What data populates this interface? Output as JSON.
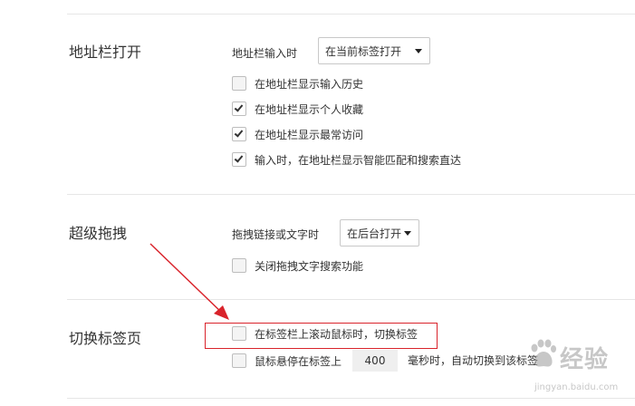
{
  "address_bar": {
    "section_title": "地址栏打开",
    "input_label": "地址栏输入时",
    "input_select": "在当前标签打开",
    "options": [
      {
        "label": "在地址栏显示输入历史",
        "checked": false
      },
      {
        "label": "在地址栏显示个人收藏",
        "checked": true
      },
      {
        "label": "在地址栏显示最常访问",
        "checked": true
      },
      {
        "label": "输入时，在地址栏显示智能匹配和搜索直达",
        "checked": true
      }
    ]
  },
  "drag": {
    "section_title": "超级拖拽",
    "drag_label": "拖拽链接或文字时",
    "drag_select": "在后台打开",
    "option": {
      "label": "关闭拖拽文字搜索功能",
      "checked": false
    }
  },
  "tab_switch": {
    "section_title": "切换标签页",
    "scroll_option": {
      "label": "在标签栏上滚动鼠标时，切换标签",
      "checked": false
    },
    "hover_option": {
      "label": "鼠标悬停在标签上",
      "checked": false
    },
    "hover_ms": "400",
    "hover_suffix": "毫秒时，自动切换到该标签"
  },
  "annotation": {
    "highlight_color": "#d9232b"
  },
  "watermark": {
    "text": "经验",
    "sub": "jingyan.baidu.com",
    "icon": "baidu-paw-icon"
  }
}
